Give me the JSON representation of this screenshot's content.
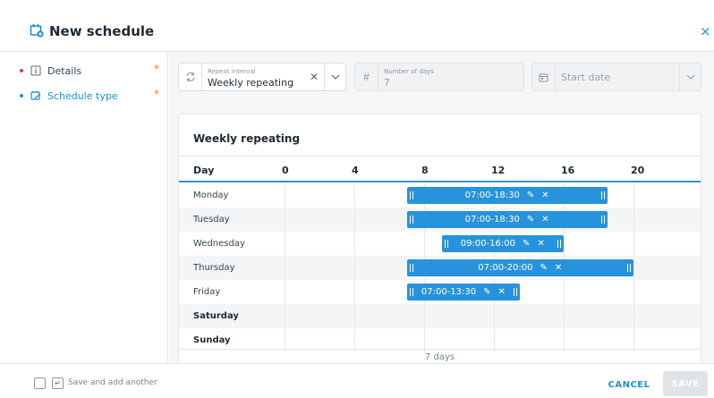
{
  "header": {
    "title": "New schedule",
    "close_label": "×"
  },
  "sidebar": {
    "items": [
      {
        "label": "Details",
        "required": "*"
      },
      {
        "label": "Schedule type",
        "required": "*"
      }
    ]
  },
  "fields": {
    "repeat_interval": {
      "label": "Repeat interval",
      "value": "Weekly repeating"
    },
    "number_of_days": {
      "label": "Number of days",
      "value": "7"
    },
    "start_date": {
      "placeholder": "Start date"
    }
  },
  "schedule": {
    "title": "Weekly repeating",
    "day_header": "Day",
    "hour_labels": [
      "0",
      "4",
      "8",
      "12",
      "16",
      "20"
    ],
    "footer": "7 days",
    "rows": [
      {
        "day": "Monday",
        "start": 7,
        "end": 18.5,
        "label": "07:00-18:30"
      },
      {
        "day": "Tuesday",
        "start": 7,
        "end": 18.5,
        "label": "07:00-18:30"
      },
      {
        "day": "Wednesday",
        "start": 9,
        "end": 16,
        "label": "09:00-16:00"
      },
      {
        "day": "Thursday",
        "start": 7,
        "end": 20,
        "label": "07:00-20:00"
      },
      {
        "day": "Friday",
        "start": 7,
        "end": 13.5,
        "label": "07:00-13:30"
      },
      {
        "day": "Saturday"
      },
      {
        "day": "Sunday"
      }
    ]
  },
  "bottom": {
    "save_another_label": "Save and add another",
    "cancel_label": "CANCEL",
    "save_label": "SAVE"
  },
  "colors": {
    "accent": "#1b8fd9",
    "bar": "#2793dc",
    "required": "#f08a24",
    "error_dot": "#e33b3b"
  }
}
